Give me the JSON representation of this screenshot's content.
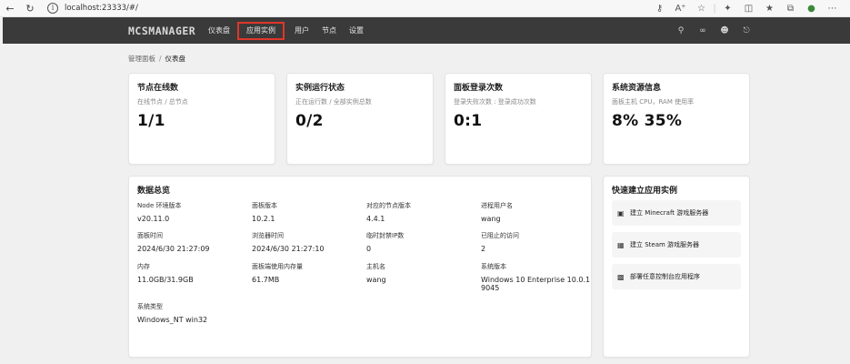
{
  "browser": {
    "url": "localhost:23333/#/",
    "back_icon": "arrow-left",
    "refresh_icon": "refresh",
    "info_icon": "info-circle"
  },
  "header": {
    "logo": "MCSMANAGER",
    "nav": [
      {
        "label": "仪表盘"
      },
      {
        "label": "应用实例",
        "highlighted": true
      },
      {
        "label": "用户"
      },
      {
        "label": "节点"
      },
      {
        "label": "设置"
      }
    ],
    "highlight_color": "#e0362b",
    "background": "#3a3a3a"
  },
  "breadcrumb": {
    "root": "管理面板",
    "separator": "/",
    "current": "仪表盘"
  },
  "stats": [
    {
      "title": "节点在线数",
      "subtitle": "在线节点 / 总节点",
      "value": "1/1"
    },
    {
      "title": "实例运行状态",
      "subtitle": "正在运行数 / 全部实例总数",
      "value": "0/2"
    },
    {
      "title": "面板登录次数",
      "subtitle": "登录失败次数 : 登录成功次数",
      "value": "0:1"
    },
    {
      "title": "系统资源信息",
      "subtitle": "面板主机 CPU，RAM 使用率",
      "value": "8% 35%"
    }
  ],
  "overview": {
    "title": "数据总览",
    "items": [
      {
        "label": "Node 环境版本",
        "value": "v20.11.0"
      },
      {
        "label": "面板版本",
        "value": "10.2.1"
      },
      {
        "label": "对应的节点版本",
        "value": "4.4.1"
      },
      {
        "label": "进程用户名",
        "value": "wang"
      },
      {
        "label": "面板时间",
        "value": "2024/6/30 21:27:09"
      },
      {
        "label": "浏览器时间",
        "value": "2024/6/30 21:27:10"
      },
      {
        "label": "临时封禁IP数",
        "value": "0"
      },
      {
        "label": "已阻止的访问",
        "value": "2"
      },
      {
        "label": "内存",
        "value": "11.0GB/31.9GB"
      },
      {
        "label": "面板端使用内存量",
        "value": "61.7MB"
      },
      {
        "label": "主机名",
        "value": "wang"
      },
      {
        "label": "系统版本",
        "value": "Windows 10 Enterprise 10.0.19045"
      },
      {
        "label": "系统类型",
        "value": "Windows_NT win32"
      }
    ]
  },
  "quick": {
    "title": "快速建立应用实例",
    "items": [
      {
        "label": "建立 Minecraft 游戏服务器",
        "icon": "minecraft-icon"
      },
      {
        "label": "建立 Steam 游戏服务器",
        "icon": "steam-icon"
      },
      {
        "label": "部署任意控制台应用程序",
        "icon": "console-icon"
      }
    ]
  }
}
